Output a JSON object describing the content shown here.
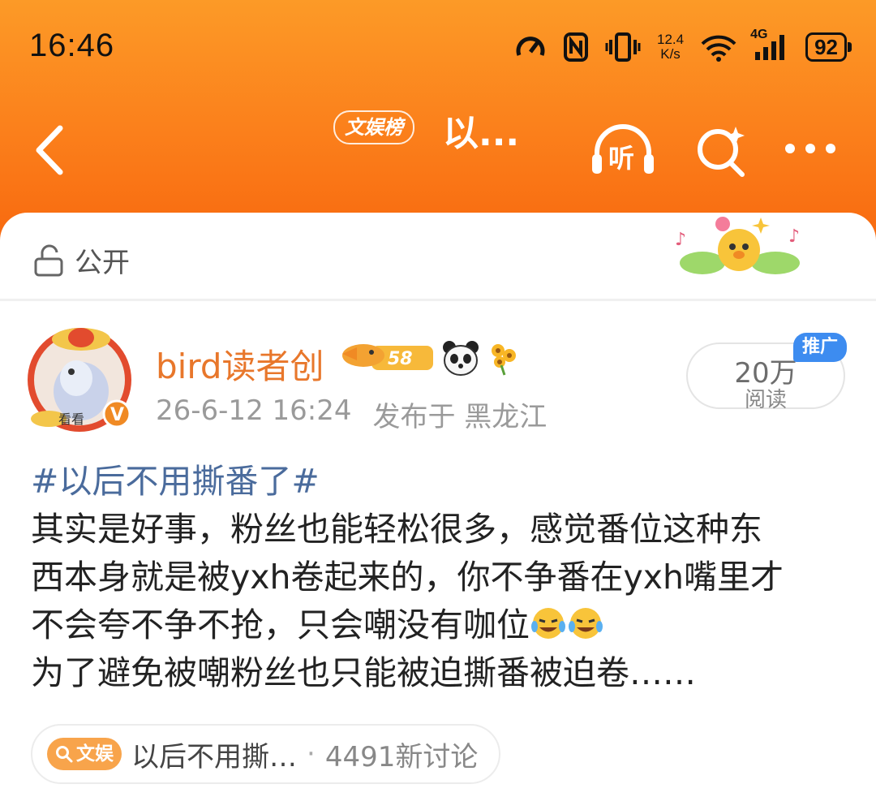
{
  "status": {
    "time": "16:46",
    "net_speed_value": "12.4",
    "net_speed_unit": "K/s",
    "signal_type": "4G",
    "battery": "92"
  },
  "nav": {
    "chip": "文娱榜",
    "title": "以...",
    "listen_label": "听",
    "icons": [
      "back-icon",
      "listen-headphone-icon",
      "search-icon",
      "more-icon"
    ]
  },
  "visibility": {
    "icon": "lock-icon",
    "label": "公开"
  },
  "author": {
    "name": "bird读者创",
    "level": "58",
    "badges": [
      "bird-level-badge",
      "panda-badge",
      "flower-badge"
    ],
    "avatar_text": "看看",
    "verified": "V"
  },
  "meta": {
    "date": "26-6-12 16:24",
    "location": "发布于 黑龙江"
  },
  "reads": {
    "count": "20万",
    "label": "阅读",
    "ad_tag": "推广"
  },
  "post": {
    "hashtag": "#以后不用撕番了#",
    "line1": "其实是好事，粉丝也能轻松很多，感觉番位这种东",
    "line2": "西本身就是被yxh卷起来的，你不争番在yxh嘴里才",
    "line3": "不会夸不争不抢，只会嘲没有咖位",
    "line4": "为了避免被嘲粉丝也只能被迫撕番被迫卷……"
  },
  "topic": {
    "chip": "文娱",
    "title": "以后不用撕…",
    "separator": "·",
    "count": "4491新讨论"
  },
  "colors": {
    "header_orange": "#fb7f1b",
    "username": "#e8772b",
    "hashtag": "#4a6b9c",
    "ad_blue": "#3d8cf0",
    "topic_chip": "#f8a44b"
  }
}
